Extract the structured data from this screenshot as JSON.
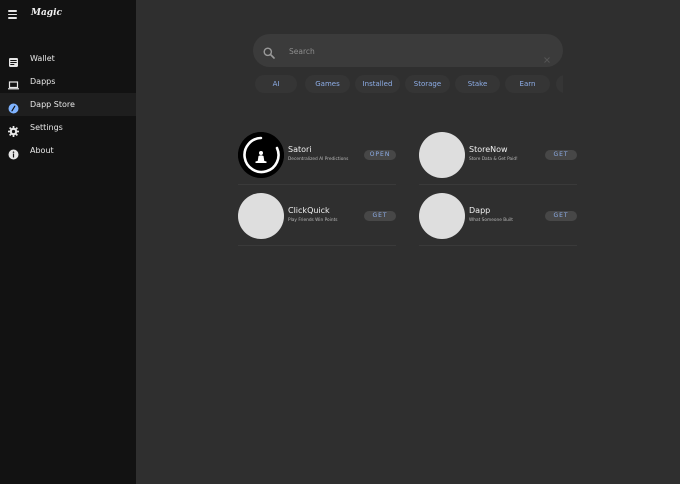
{
  "sidebar": {
    "logo": "Magic",
    "items": [
      {
        "label": "Wallet",
        "icon": "wallet-icon"
      },
      {
        "label": "Dapps",
        "icon": "laptop-icon"
      },
      {
        "label": "Dapp Store",
        "icon": "dapp-store-icon",
        "active": true
      },
      {
        "label": "Settings",
        "icon": "gear-icon"
      },
      {
        "label": "About",
        "icon": "info-icon"
      }
    ]
  },
  "search": {
    "placeholder": "Search",
    "value": ""
  },
  "categories": [
    "AI",
    "Games",
    "Installed",
    "Storage",
    "Stake",
    "Earn"
  ],
  "apps": [
    {
      "name": "Satori",
      "description": "Decentralized AI Predictions",
      "action": "OPEN"
    },
    {
      "name": "StoreNow",
      "description": "Store Data & Get Paid!",
      "action": "GET"
    },
    {
      "name": "ClickQuick",
      "description": "Play Friends Win Points",
      "action": "GET"
    },
    {
      "name": "Dapp",
      "description": "What Someone Built",
      "action": "GET"
    }
  ],
  "colors": {
    "accent": "#8eaee8",
    "sidebar_bg": "#121212",
    "main_bg": "#2f2f2f",
    "active_dot": "#7fb3ff"
  }
}
